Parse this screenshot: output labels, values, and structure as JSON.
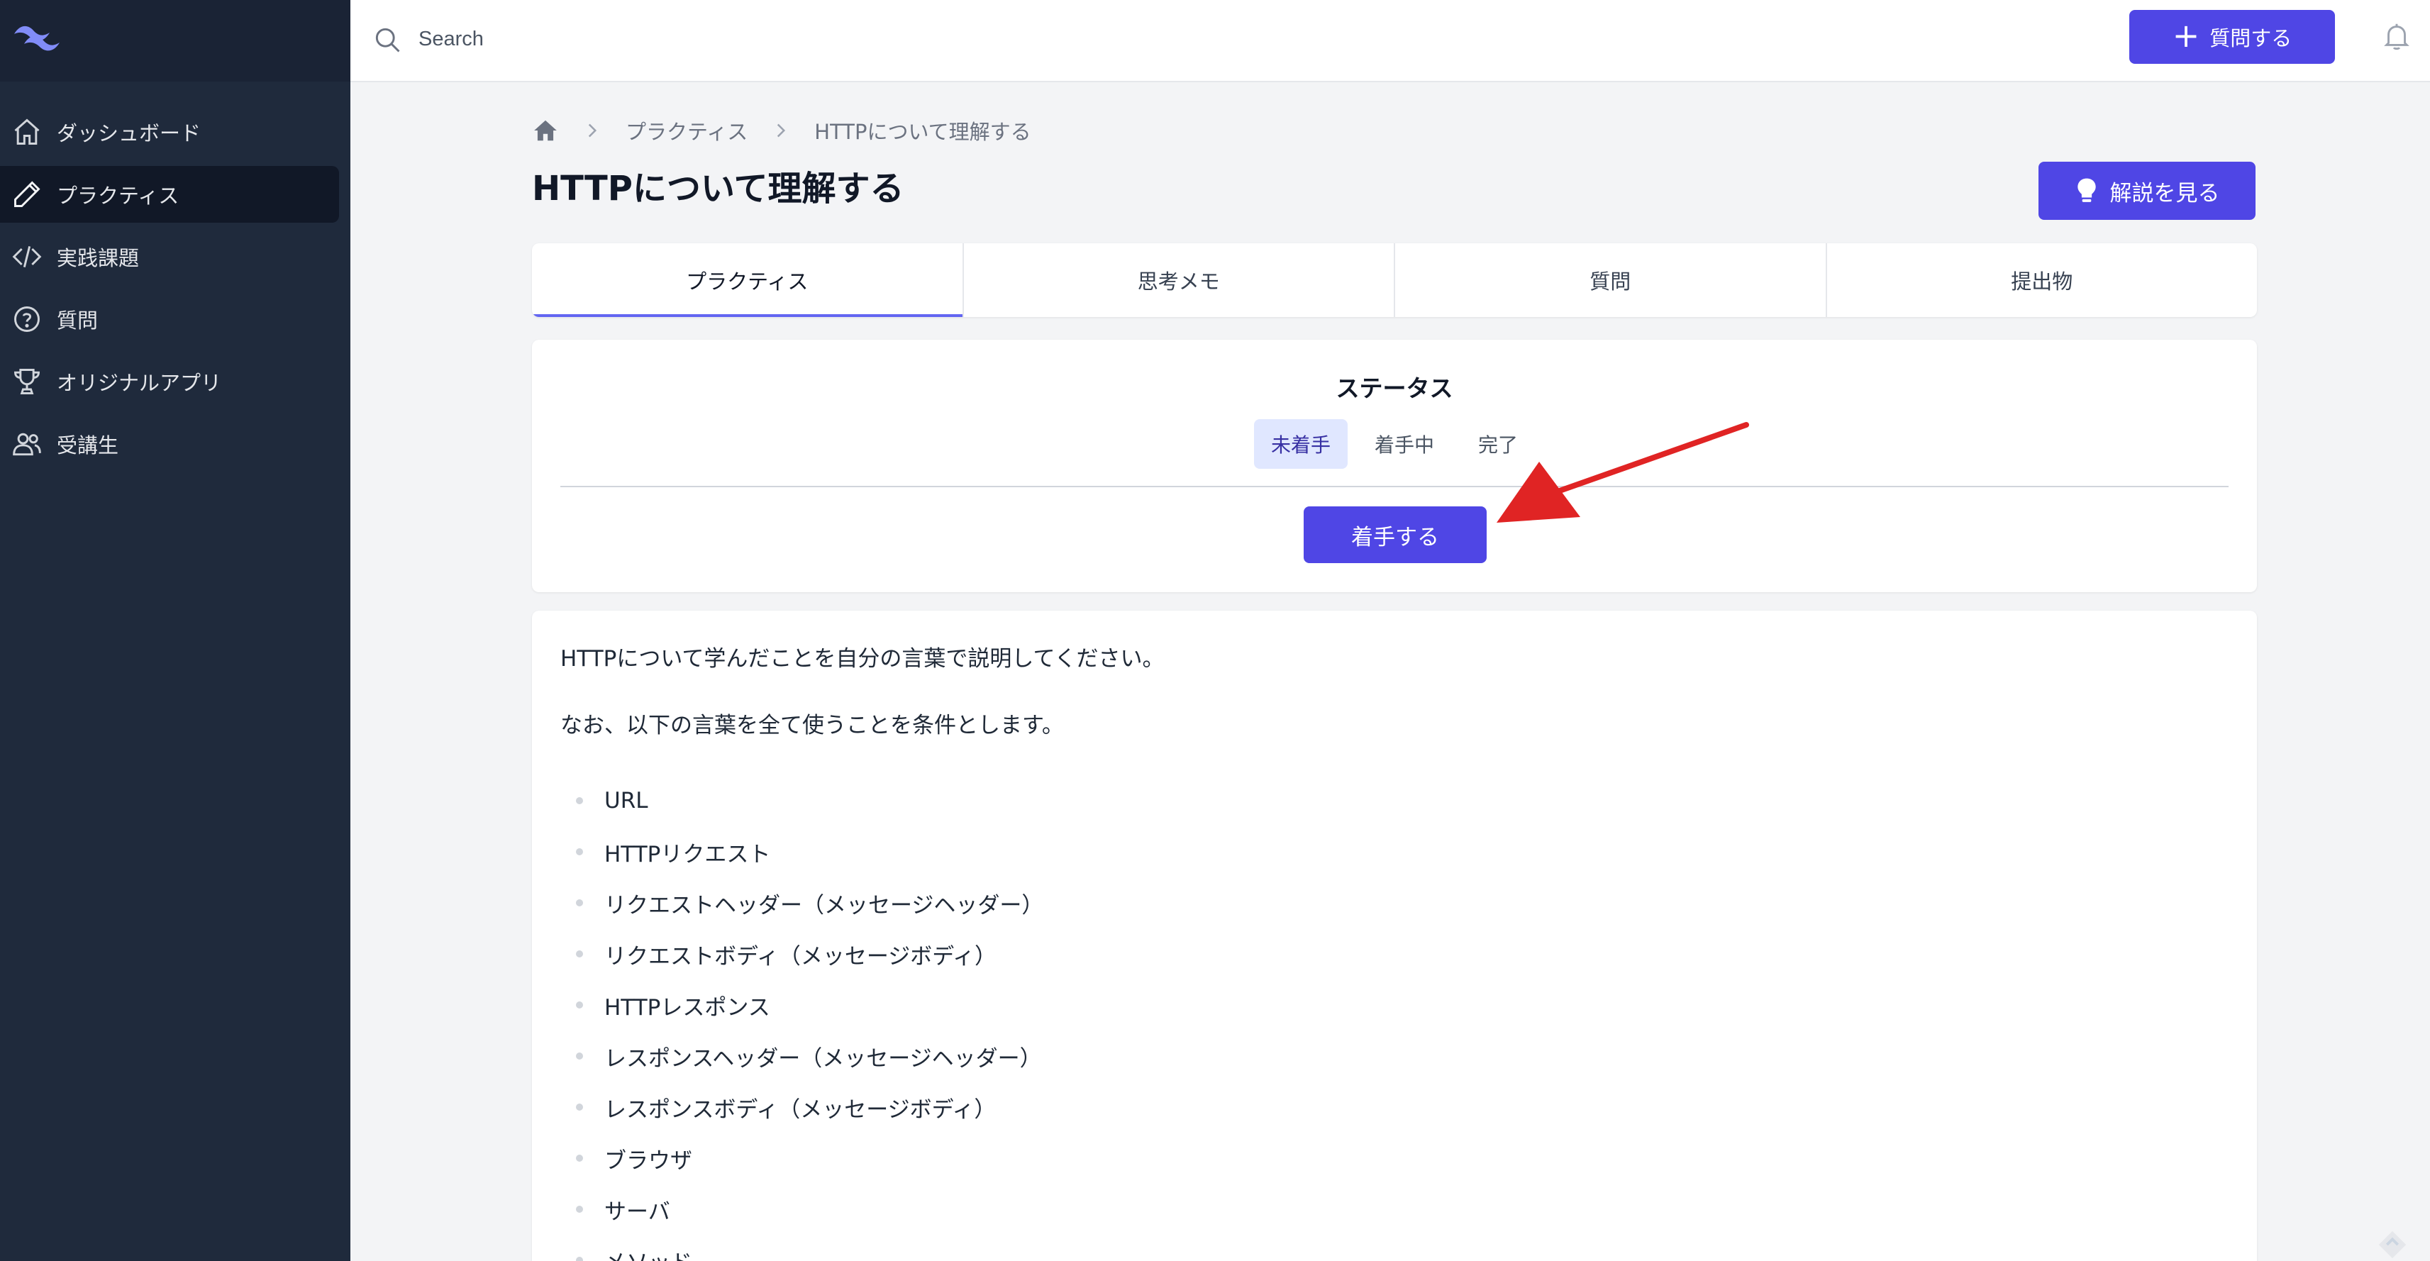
{
  "sidebar": {
    "items": [
      {
        "label": "ダッシュボード",
        "icon": "home-icon"
      },
      {
        "label": "プラクティス",
        "icon": "pencil-icon"
      },
      {
        "label": "実践課題",
        "icon": "code-icon"
      },
      {
        "label": "質問",
        "icon": "question-circle-icon"
      },
      {
        "label": "オリジナルアプリ",
        "icon": "trophy-icon"
      },
      {
        "label": "受講生",
        "icon": "users-icon"
      }
    ]
  },
  "topbar": {
    "search_placeholder": "Search",
    "ask_button": "質問する"
  },
  "breadcrumb": {
    "items": [
      "プラクティス",
      "HTTPについて理解する"
    ]
  },
  "page": {
    "title": "HTTPについて理解する",
    "explain_button": "解説を見る"
  },
  "tabs": [
    "プラクティス",
    "思考メモ",
    "質問",
    "提出物"
  ],
  "status": {
    "title": "ステータス",
    "options": [
      "未着手",
      "着手中",
      "完了"
    ],
    "selected": "未着手",
    "start_button": "着手する"
  },
  "content": {
    "paragraphs": [
      "HTTPについて学んだことを自分の言葉で説明してください。",
      "なお、以下の言葉を全て使うことを条件とします。"
    ],
    "items": [
      "URL",
      "HTTPリクエスト",
      "リクエストヘッダー（メッセージヘッダー）",
      "リクエストボディ（メッセージボディ）",
      "HTTPレスポンス",
      "レスポンスヘッダー（メッセージヘッダー）",
      "レスポンスボディ（メッセージボディ）",
      "ブラウザ",
      "サーバ",
      "メソッド"
    ]
  },
  "colors": {
    "sidebar_bg": "#1f2a3c",
    "primary": "#4f46e5",
    "arrow": "#e02424"
  }
}
